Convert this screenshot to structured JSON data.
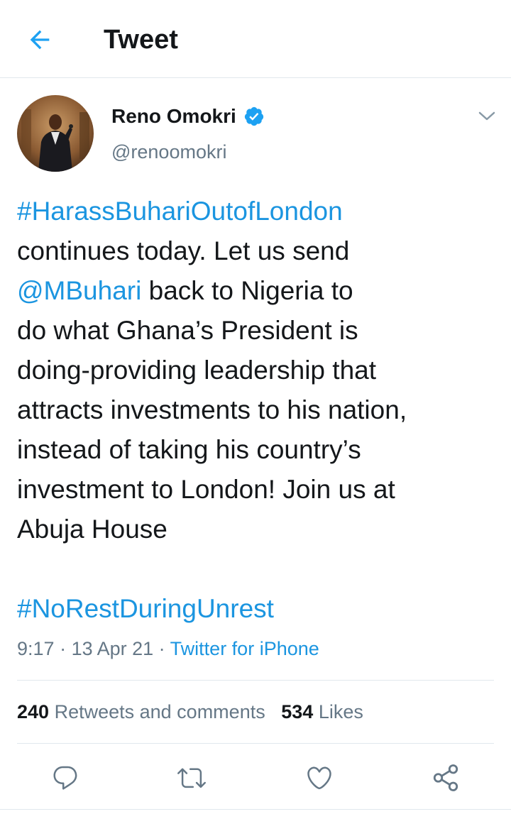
{
  "header": {
    "title": "Tweet",
    "back_icon": "arrow-left-icon",
    "accent": "#1da1f2"
  },
  "author": {
    "display_name": "Reno Omokri",
    "handle": "@renoomokri",
    "verified": true,
    "verified_icon": "verified-badge-icon"
  },
  "tweet": {
    "lines": [
      [
        {
          "t": "#HarassBuhariOutofLondon",
          "link": true
        }
      ],
      [
        {
          "t": "continues today. Let us send",
          "link": false
        }
      ],
      [
        {
          "t": "@MBuhari",
          "link": true
        },
        {
          "t": " back to Nigeria to",
          "link": false
        }
      ],
      [
        {
          "t": "do what Ghana’s President is",
          "link": false
        }
      ],
      [
        {
          "t": "doing-providing leadership that",
          "link": false
        }
      ],
      [
        {
          "t": "attracts investments to his nation,",
          "link": false
        }
      ],
      [
        {
          "t": "instead of taking his country’s",
          "link": false
        }
      ],
      [
        {
          "t": "investment to London! Join us at",
          "link": false
        }
      ],
      [
        {
          "t": "Abuja House",
          "link": false
        }
      ],
      [],
      [
        {
          "t": "#NoRestDuringUnrest",
          "link": true
        }
      ]
    ],
    "link_color": "#1b95e0"
  },
  "meta": {
    "time": "9:17",
    "separator": " · ",
    "date": "13 Apr 21",
    "source": "Twitter for iPhone"
  },
  "stats": {
    "retweets_count": "240",
    "retweets_label": "Retweets and comments",
    "likes_count": "534",
    "likes_label": "Likes"
  },
  "actions": [
    {
      "name": "reply-button",
      "icon": "reply-icon"
    },
    {
      "name": "retweet-button",
      "icon": "retweet-icon"
    },
    {
      "name": "like-button",
      "icon": "heart-icon"
    },
    {
      "name": "share-button",
      "icon": "share-icon"
    }
  ]
}
